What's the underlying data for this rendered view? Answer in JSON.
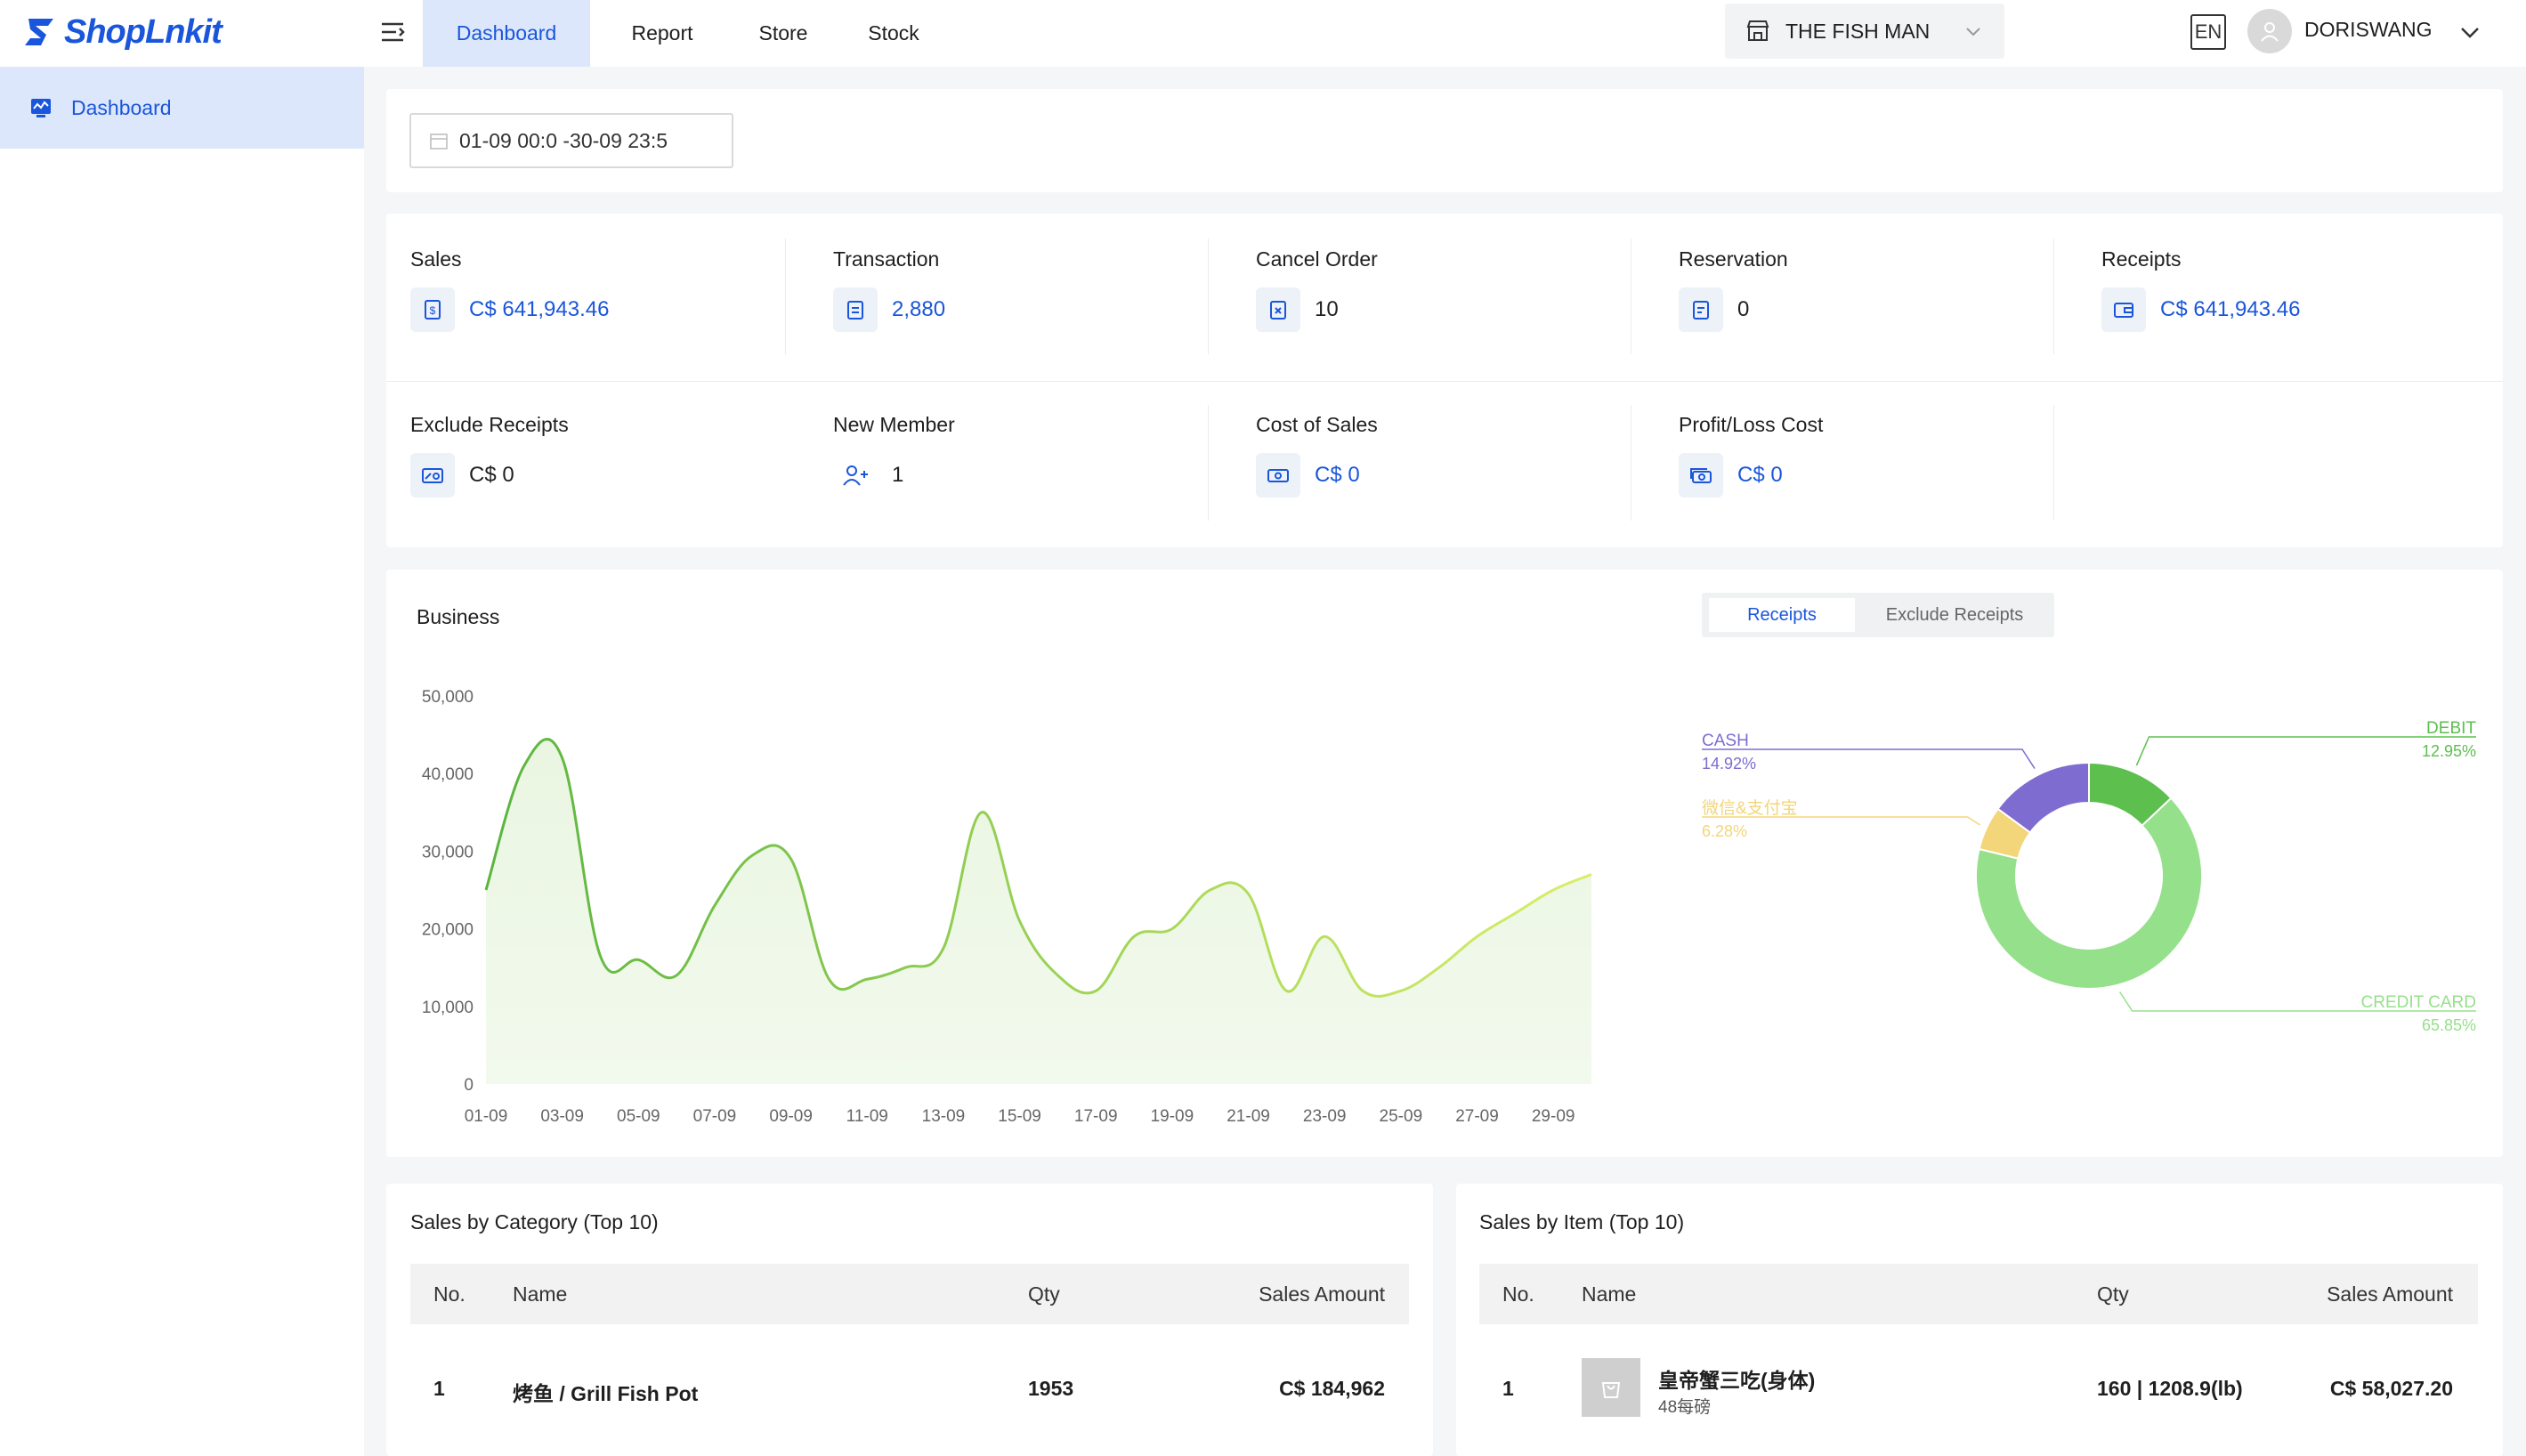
{
  "app": {
    "logo_text": "ShopLnkit"
  },
  "sidebar": {
    "items": [
      {
        "label": "Dashboard",
        "icon": "dashboard-icon"
      }
    ]
  },
  "header": {
    "tabs": [
      {
        "label": "Dashboard"
      },
      {
        "label": "Report"
      },
      {
        "label": "Store"
      },
      {
        "label": "Stock"
      }
    ],
    "store": "THE FISH MAN",
    "lang": "EN",
    "user": "DORISWANG"
  },
  "filter": {
    "date_range": "01-09 00:0  -30-09 23:5"
  },
  "stats": {
    "sales": {
      "label": "Sales",
      "value": "C$ 641,943.46"
    },
    "transaction": {
      "label": "Transaction",
      "value": "2,880"
    },
    "cancel": {
      "label": "Cancel Order",
      "value": "10"
    },
    "reservation": {
      "label": "Reservation",
      "value": "0"
    },
    "receipts": {
      "label": "Receipts",
      "value": "C$ 641,943.46"
    },
    "exclude": {
      "label": "Exclude Receipts",
      "value": "C$ 0"
    },
    "member": {
      "label": "New Member",
      "value": "1"
    },
    "cost": {
      "label": "Cost of Sales",
      "value": "C$ 0"
    },
    "profit": {
      "label": "Profit/Loss Cost",
      "value": "C$ 0"
    }
  },
  "business": {
    "title": "Business",
    "toggle": {
      "receipts": "Receipts",
      "exclude": "Exclude Receipts"
    }
  },
  "chart_data": [
    {
      "type": "area",
      "title": "",
      "xlabel": "",
      "ylabel": "",
      "ylim": [
        0,
        50000
      ],
      "yticks": [
        "0",
        "10,000",
        "20,000",
        "30,000",
        "40,000",
        "50,000"
      ],
      "x_tick_labels": [
        "01-09",
        "03-09",
        "05-09",
        "07-09",
        "09-09",
        "11-09",
        "13-09",
        "15-09",
        "17-09",
        "19-09",
        "21-09",
        "23-09",
        "25-09",
        "27-09",
        "29-09"
      ],
      "x": [
        "01-09",
        "02-09",
        "03-09",
        "04-09",
        "05-09",
        "06-09",
        "07-09",
        "08-09",
        "09-09",
        "10-09",
        "11-09",
        "12-09",
        "13-09",
        "14-09",
        "15-09",
        "16-09",
        "17-09",
        "18-09",
        "19-09",
        "20-09",
        "21-09",
        "22-09",
        "23-09",
        "24-09",
        "25-09",
        "26-09",
        "27-09",
        "28-09",
        "29-09",
        "30-09"
      ],
      "values": [
        25000,
        41000,
        42000,
        16500,
        16000,
        14000,
        23000,
        29500,
        29000,
        13500,
        13500,
        15000,
        17500,
        35000,
        21000,
        14000,
        12000,
        19000,
        20000,
        25000,
        24500,
        12000,
        19000,
        12000,
        12000,
        15000,
        19000,
        22000,
        25000,
        27000
      ],
      "grid": false,
      "colors": {
        "start": "#5ab53f",
        "end": "#d9ee6a",
        "fill": "#e6f4dc"
      }
    },
    {
      "type": "pie",
      "slices": [
        {
          "label": "DEBIT",
          "value": 12.95,
          "display": "12.95%",
          "color": "#5cbf4e"
        },
        {
          "label": "CREDIT CARD",
          "value": 65.85,
          "display": "65.85%",
          "color": "#95e08a"
        },
        {
          "label": "微信&支付宝",
          "value": 6.28,
          "display": "6.28%",
          "color": "#f3d57a"
        },
        {
          "label": "CASH",
          "value": 14.92,
          "display": "14.92%",
          "color": "#7f6cd0"
        }
      ]
    }
  ],
  "category_table": {
    "title": "Sales by Category (Top 10)",
    "columns": {
      "no": "No.",
      "name": "Name",
      "qty": "Qty",
      "amount": "Sales Amount"
    },
    "rows": [
      {
        "no": "1",
        "name": "烤鱼 / Grill Fish Pot",
        "qty": "1953",
        "amount": "C$ 184,962"
      }
    ]
  },
  "item_table": {
    "title": "Sales by Item (Top 10)",
    "columns": {
      "no": "No.",
      "name": "Name",
      "qty": "Qty",
      "amount": "Sales Amount"
    },
    "rows": [
      {
        "no": "1",
        "name": "皇帝蟹三吃(身体)",
        "sub": "48每磅",
        "qty": "160 | 1208.9(lb)",
        "amount": "C$ 58,027.20"
      }
    ]
  }
}
